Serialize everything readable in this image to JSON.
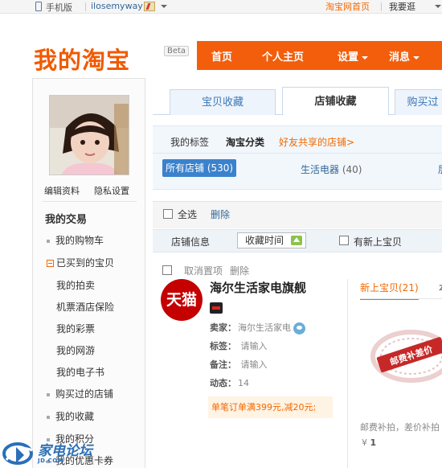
{
  "topbar": {
    "mobile_label": "手机版",
    "username": "ilosemyway",
    "home_link": "淘宝网首页",
    "browse_label": "我要逛"
  },
  "header": {
    "logo": "我的淘宝",
    "beta": "Beta",
    "nav": [
      "首页",
      "个人主页",
      "设置",
      "消息"
    ]
  },
  "sidebar": {
    "edit_profile": "编辑资料",
    "privacy": "隐私设置",
    "section_title": "我的交易",
    "items": [
      {
        "label": "我的购物车",
        "type": "dot"
      },
      {
        "label": "已买到的宝贝",
        "type": "minus"
      },
      {
        "label": "我的拍卖",
        "type": "sub"
      },
      {
        "label": "机票酒店保险",
        "type": "sub"
      },
      {
        "label": "我的彩票",
        "type": "sub"
      },
      {
        "label": "我的网游",
        "type": "sub"
      },
      {
        "label": "我的电子书",
        "type": "sub"
      },
      {
        "label": "购买过的店铺",
        "type": "dot"
      },
      {
        "label": "我的收藏",
        "type": "dot"
      },
      {
        "label": "我的积分",
        "type": "dot"
      },
      {
        "label": "我的优惠卡券",
        "type": "dot"
      }
    ]
  },
  "tabs": [
    "宝贝收藏",
    "店铺收藏",
    "购买过"
  ],
  "subnav": {
    "my_tags": "我的标签",
    "taobao_categories": "淘宝分类",
    "shared_shops": "好友共享的店铺>",
    "all_shops": "所有店铺 (530)",
    "cat_appliance": "生活电器",
    "cat_appliance_count": "(40)",
    "cat_more": "层"
  },
  "toolbar": {
    "select_all": "全选",
    "delete": "删除",
    "shop_info": "店铺信息",
    "sort_label": "收藏时间",
    "new_items_filter": "有新上宝贝"
  },
  "shop": {
    "unselect": "取消置项",
    "delete": "删除",
    "logo_text": "天猫",
    "name": "海尔生活家电旗舰",
    "seller_label": "卖家：",
    "seller": "海尔生活家电",
    "tag_label": "标签：",
    "tag_value": "请输入",
    "note_label": "备注：",
    "note_value": "请输入",
    "feed_label": "动态：",
    "feed_value": "14",
    "promo": "单笔订单满399元,减20元;",
    "new_items_tab": "新上宝贝(21)",
    "other_tab": "本",
    "stamp_text": "邮费补差价",
    "item_desc": "邮费补拍，差价补拍",
    "item_price_symbol": "¥",
    "item_price": "1"
  },
  "watermark": {
    "title": "家电论坛",
    "sub": "JD.COM"
  },
  "colors": {
    "brand_orange": "#f25e0c",
    "link_blue": "#336699",
    "tmall_red": "#c40000",
    "selected_blue": "#3a82cc"
  }
}
